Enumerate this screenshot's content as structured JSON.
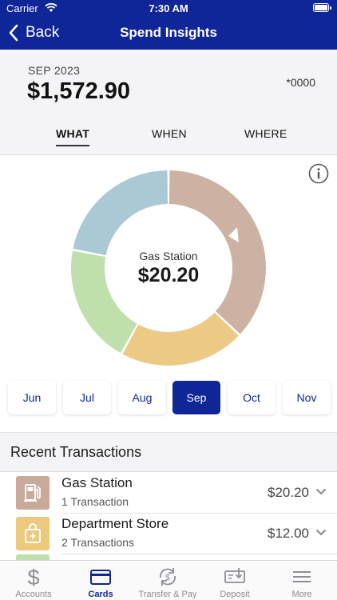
{
  "status_bar": {
    "carrier": "Carrier",
    "time": "7:30 AM"
  },
  "nav": {
    "back_label": "Back",
    "title": "Spend Insights"
  },
  "summary": {
    "period": "SEP 2023",
    "amount": "$1,572.90",
    "account": "*0000"
  },
  "tabs": [
    {
      "label": "WHAT",
      "selected": true
    },
    {
      "label": "WHEN",
      "selected": false
    },
    {
      "label": "WHERE",
      "selected": false
    }
  ],
  "chart_data": {
    "type": "pie",
    "style": "donut",
    "center_label": "Gas Station",
    "center_value": "$20.20",
    "slice_colors": [
      "#cdb1a2",
      "#ecca86",
      "#bfe0ac",
      "#aac9d4"
    ],
    "slice_fractions": [
      0.37,
      0.21,
      0.2,
      0.22
    ]
  },
  "months": [
    {
      "label": "Jun",
      "selected": false
    },
    {
      "label": "Jul",
      "selected": false
    },
    {
      "label": "Aug",
      "selected": false
    },
    {
      "label": "Sep",
      "selected": true
    },
    {
      "label": "Oct",
      "selected": false
    },
    {
      "label": "Nov",
      "selected": false
    }
  ],
  "recent": {
    "title": "Recent Transactions",
    "items": [
      {
        "name": "Gas Station",
        "count": "1 Transaction",
        "amount": "$20.20",
        "icon": "gas-pump-icon",
        "icon_bg": "#c8a99a"
      },
      {
        "name": "Department Store",
        "count": "2 Transactions",
        "amount": "$12.00",
        "icon": "shopping-bag-icon",
        "icon_bg": "#ecc97c"
      }
    ]
  },
  "tabbar": [
    {
      "label": "Accounts",
      "icon": "dollar-icon",
      "active": false
    },
    {
      "label": "Cards",
      "icon": "card-icon",
      "active": true
    },
    {
      "label": "Transfer & Pay",
      "icon": "transfer-icon",
      "active": false
    },
    {
      "label": "Deposit",
      "icon": "deposit-icon",
      "active": false
    },
    {
      "label": "More",
      "icon": "menu-icon",
      "active": false
    }
  ],
  "colors": {
    "brand": "#0f2598",
    "summary_bg": "#f4f4f6"
  }
}
